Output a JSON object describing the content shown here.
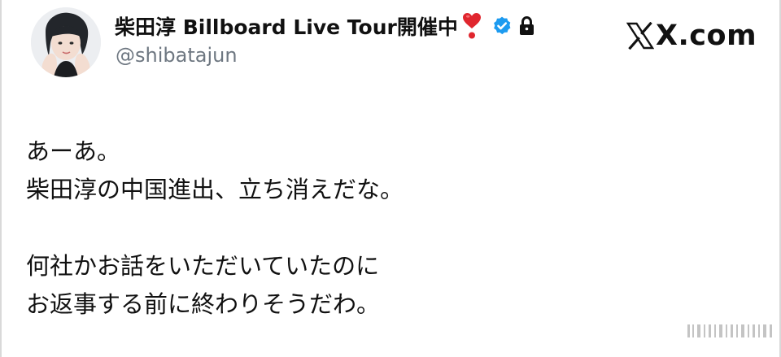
{
  "profile": {
    "display_name": "柴田淳 Billboard Live Tour開催中",
    "handle": "@shibatajun",
    "avatar_icon": "profile-photo",
    "heart_icon": "heavy-heart-exclamation-icon",
    "verified_icon": "blue-verified-badge-icon",
    "lock_icon": "lock-icon"
  },
  "watermark": {
    "text": "X.com",
    "icon": "x-logo-icon"
  },
  "tweet": {
    "paragraph1": [
      "あーあ。",
      "柴田淳の中国進出、立ち消えだな。"
    ],
    "paragraph2": [
      "何社かお話をいただいていたのに",
      "お返事する前に終わりそうだわ。"
    ]
  },
  "colors": {
    "verified_blue": "#1d9bf0",
    "heart_red": "#e0262e",
    "handle_gray": "#6e7781",
    "text_dark": "#111111"
  }
}
